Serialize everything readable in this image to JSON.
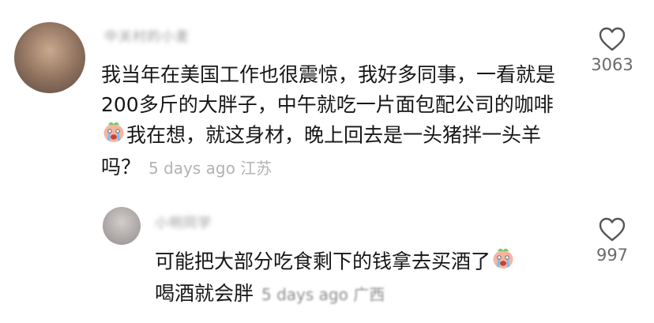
{
  "comments": [
    {
      "username": "中关村的小麦",
      "text_before_emoji": "我当年在美国工作也很震惊，我好多同事，一看就是200多斤的大胖子，中午就吃一片面包配公司的咖啡",
      "text_after_emoji": "我在想，就这身材，晚上回去是一头猪拌一头羊吗？",
      "emoji": "crying-face-icon",
      "time": "5 days ago",
      "location": "江苏",
      "likes": "3063"
    },
    {
      "username": "小明同学",
      "text_before_emoji": "可能把大部分吃食剩下的钱拿去买酒了",
      "text_after_emoji": "喝酒就会胖",
      "emoji": "crying-face-icon",
      "time": "5 days ago",
      "location": "广西",
      "likes": "997"
    }
  ],
  "colors": {
    "text": "#161616",
    "meta": "#b3b3b3",
    "likes": "#6a6a6a",
    "background": "#ffffff"
  }
}
